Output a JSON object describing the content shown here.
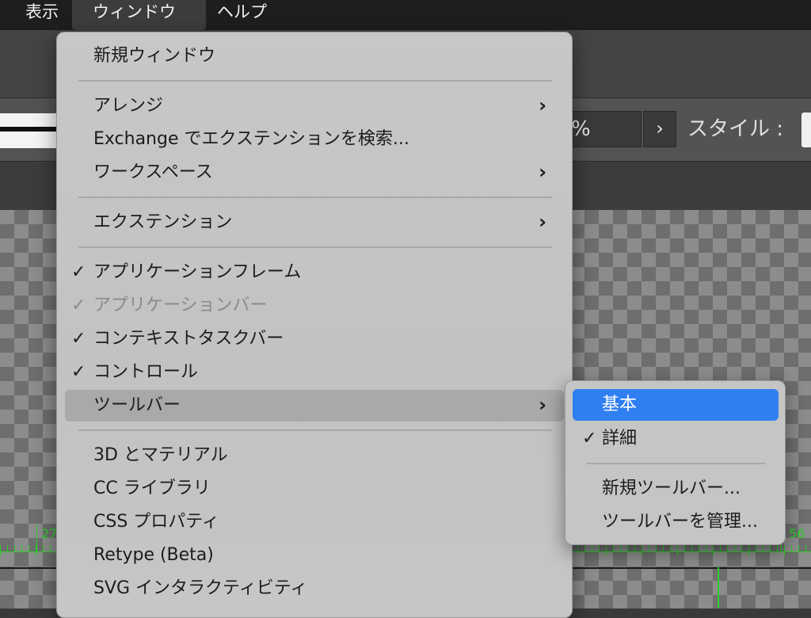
{
  "menubar": {
    "items": [
      {
        "label": "表示"
      },
      {
        "label": "ウィンドウ",
        "active": true
      },
      {
        "label": "ヘルプ"
      }
    ]
  },
  "app": {
    "opacity_value": "%",
    "opacity_chevron": "›",
    "style_label": "スタイル :",
    "ruler": {
      "left_number": "27",
      "right_number": "56"
    }
  },
  "window_menu": {
    "items": [
      {
        "label": "新規ウィンドウ",
        "checked": false,
        "submenu": false
      },
      {
        "label": "アレンジ",
        "checked": false,
        "submenu": true
      },
      {
        "label": "Exchange でエクステンションを検索...",
        "checked": false,
        "submenu": false
      },
      {
        "label": "ワークスペース",
        "checked": false,
        "submenu": true
      },
      {
        "label": "エクステンション",
        "checked": false,
        "submenu": true
      },
      {
        "label": "アプリケーションフレーム",
        "checked": true,
        "submenu": false
      },
      {
        "label": "アプリケーションバー",
        "checked": true,
        "submenu": false,
        "disabled": true
      },
      {
        "label": "コンテキストタスクバー",
        "checked": true,
        "submenu": false
      },
      {
        "label": "コントロール",
        "checked": true,
        "submenu": false
      },
      {
        "label": "ツールバー",
        "checked": false,
        "submenu": true,
        "highlighted": true
      },
      {
        "label": "3D とマテリアル",
        "checked": false,
        "submenu": false
      },
      {
        "label": "CC ライブラリ",
        "checked": false,
        "submenu": false
      },
      {
        "label": "CSS プロパティ",
        "checked": false,
        "submenu": false
      },
      {
        "label": "Retype (Beta)",
        "checked": false,
        "submenu": false
      },
      {
        "label": "SVG インタラクティビティ",
        "checked": false,
        "submenu": false
      }
    ],
    "check_glyph": "✓",
    "arrow_glyph": "›"
  },
  "toolbar_submenu": {
    "items": [
      {
        "label": "基本",
        "selected": true,
        "checked": false
      },
      {
        "label": "詳細",
        "selected": false,
        "checked": true
      },
      {
        "label": "新規ツールバー...",
        "selected": false,
        "checked": false
      },
      {
        "label": "ツールバーを管理...",
        "selected": false,
        "checked": false
      }
    ]
  },
  "colors": {
    "selection": "#2f7ff0",
    "menu_bg": "#c4c4c4",
    "guide_green": "#2cd02c"
  }
}
